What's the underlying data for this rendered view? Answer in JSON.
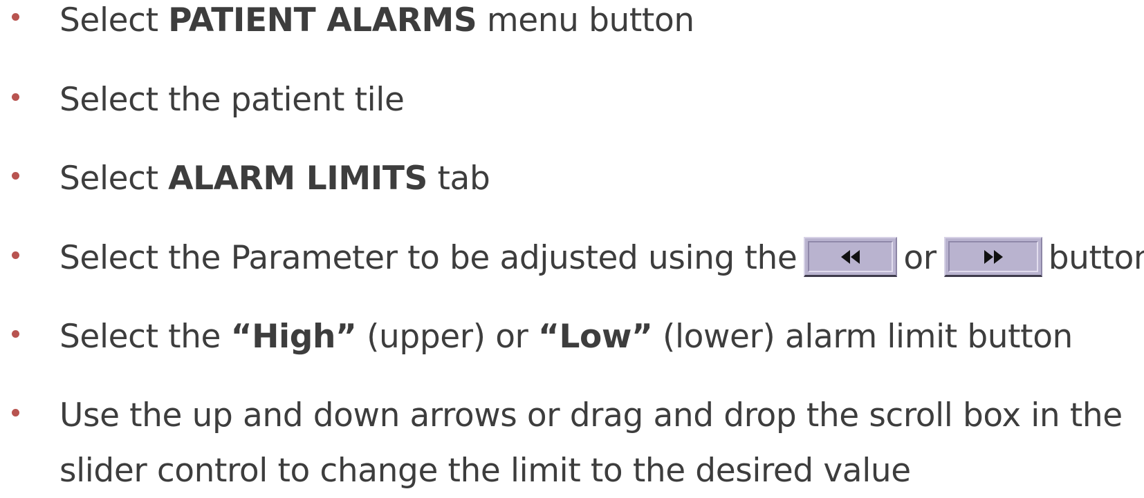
{
  "instructions": {
    "items": [
      {
        "prefix": "Select ",
        "bold": "PATIENT ALARMS",
        "suffix": " menu button"
      },
      {
        "text": "Select the patient tile"
      },
      {
        "prefix": "Select ",
        "bold": "ALARM LIMITS",
        "suffix": " tab"
      },
      {
        "prefix": "Select the Parameter to be adjusted using the",
        "middle": "or",
        "suffix": "buttons",
        "prev_icon": "double-chevron-left-icon",
        "next_icon": "double-chevron-right-icon"
      },
      {
        "prefix": "Select the ",
        "bold_high": "“High”",
        "middle": " (upper) or ",
        "bold_low": "“Low”",
        "suffix": " (lower) alarm limit button"
      },
      {
        "line1": "Use the up and down arrows or drag and drop the scroll box in the",
        "line2": "slider control to change the limit to the desired value"
      }
    ]
  },
  "colors": {
    "text": "#3d3d3d",
    "bullet": "#b85450",
    "button_face": "#b9b3cf"
  }
}
